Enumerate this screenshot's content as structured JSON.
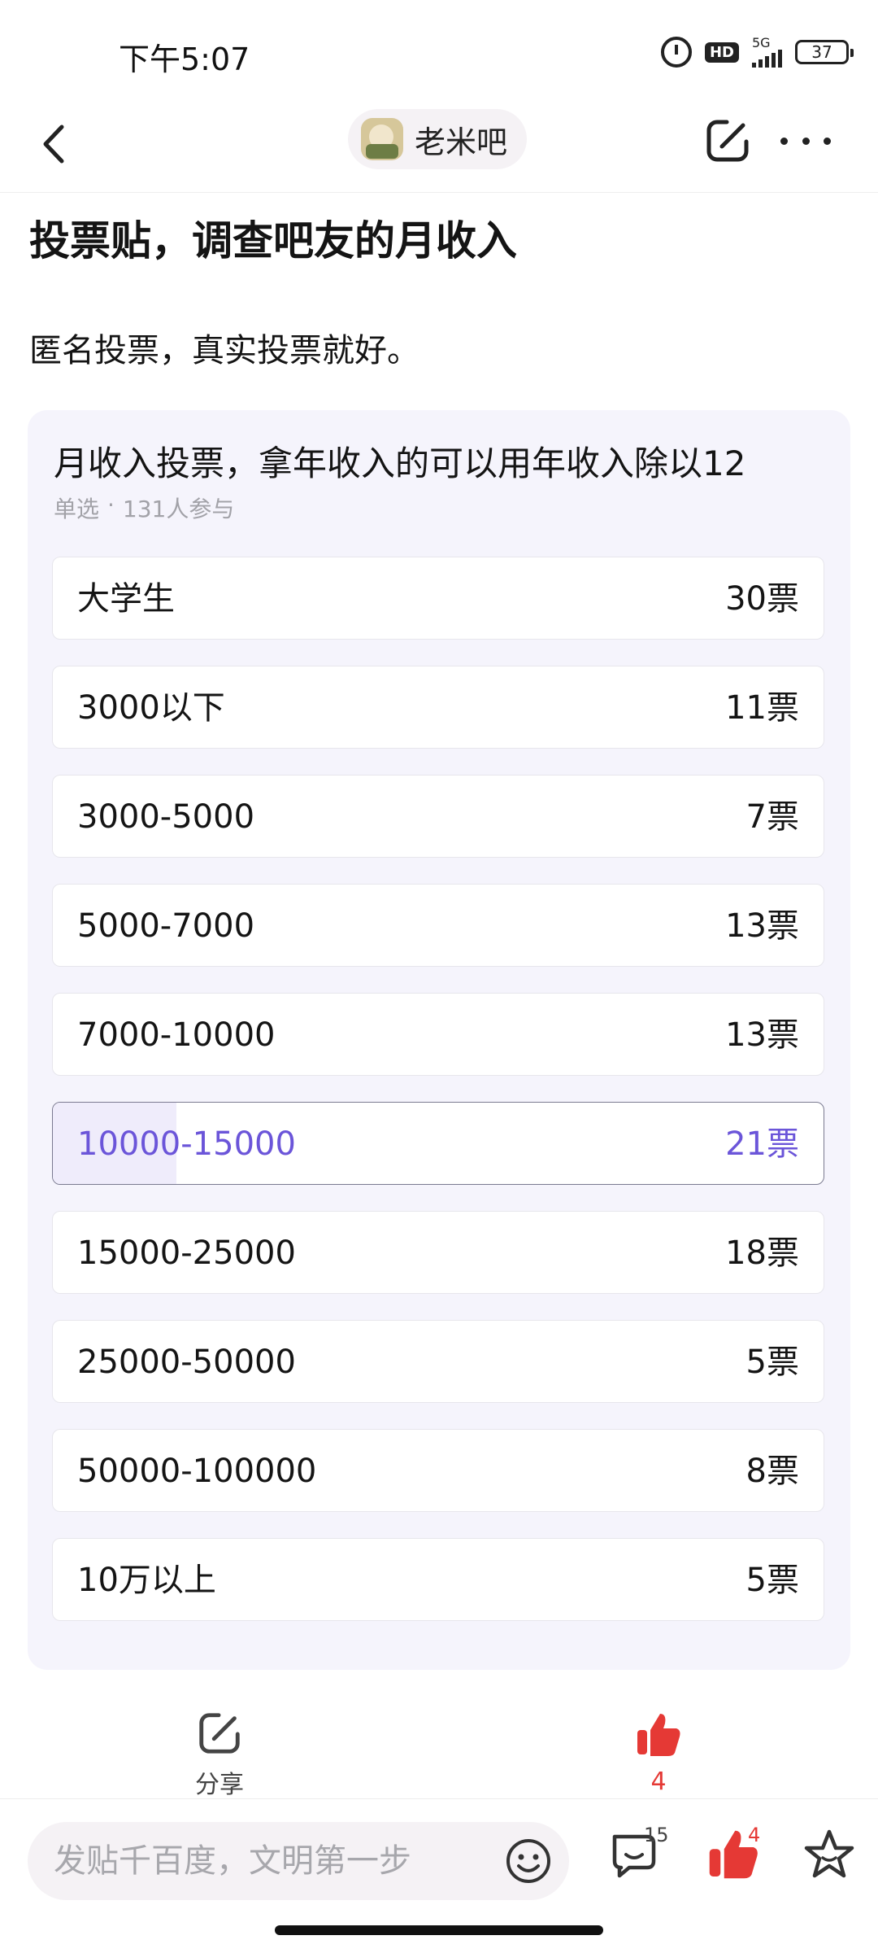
{
  "status_bar": {
    "time": "下午5:07",
    "hd": "HD",
    "network": "5G",
    "battery": "37"
  },
  "nav": {
    "forum_name": "老米吧"
  },
  "post": {
    "title": "投票贴，调查吧友的月收入",
    "body": "匿名投票，真实投票就好。"
  },
  "poll": {
    "question": "月收入投票，拿年收入的可以用年收入除以12",
    "mode": "单选",
    "separator": "·",
    "participants": "131人参与",
    "total_votes": 131,
    "selected_index": 5,
    "options": [
      {
        "label": "大学生",
        "votes": "30票",
        "count": 30
      },
      {
        "label": "3000以下",
        "votes": "11票",
        "count": 11
      },
      {
        "label": "3000-5000",
        "votes": "7票",
        "count": 7
      },
      {
        "label": "5000-7000",
        "votes": "13票",
        "count": 13
      },
      {
        "label": "7000-10000",
        "votes": "13票",
        "count": 13
      },
      {
        "label": "10000-15000",
        "votes": "21票",
        "count": 21
      },
      {
        "label": "15000-25000",
        "votes": "18票",
        "count": 18
      },
      {
        "label": "25000-50000",
        "votes": "5票",
        "count": 5
      },
      {
        "label": "50000-100000",
        "votes": "8票",
        "count": 8
      },
      {
        "label": "10万以上",
        "votes": "5票",
        "count": 5
      }
    ],
    "accent_color": "#6b55d9"
  },
  "actions": {
    "share_label": "分享",
    "like_count": "4"
  },
  "bottom_bar": {
    "input_placeholder": "发贴千百度，文明第一步",
    "comment_count": "15",
    "like_count": "4",
    "icons": [
      "emoji-icon",
      "comment-icon",
      "thumbs-up-icon",
      "star-icon"
    ]
  },
  "colors": {
    "like_red": "#e53935",
    "poll_bg": "#f5f4fc"
  }
}
